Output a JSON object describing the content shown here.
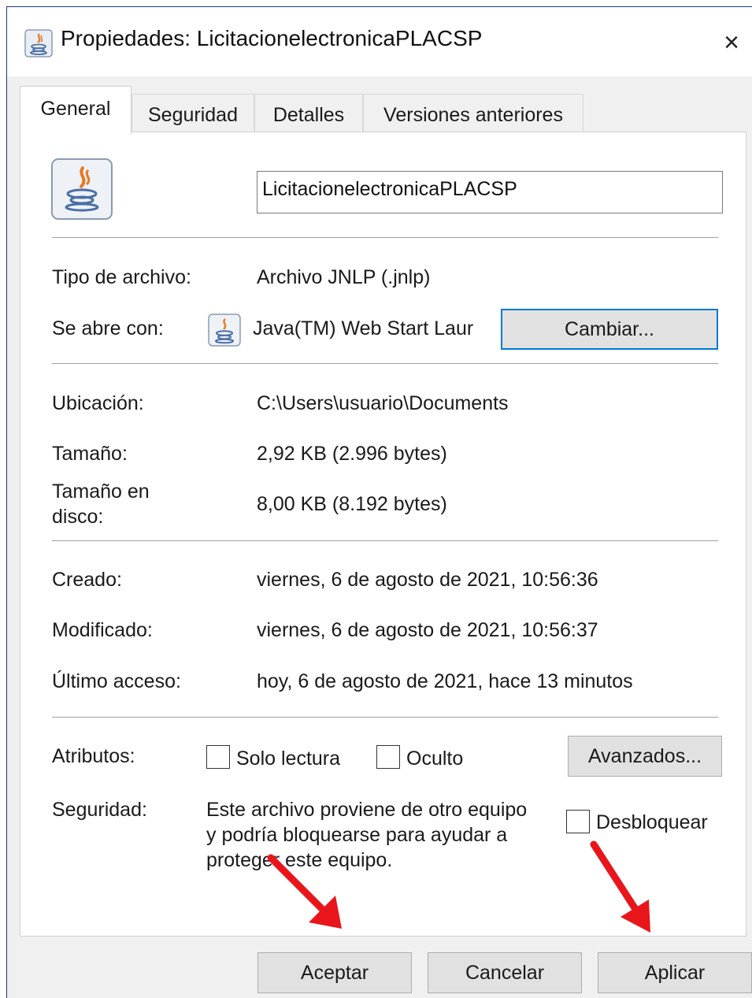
{
  "window": {
    "title": "Propiedades: LicitacionelectronicaPLACSP",
    "close_glyph": "×"
  },
  "tabs": [
    {
      "label": "General",
      "active": true
    },
    {
      "label": "Seguridad",
      "active": false
    },
    {
      "label": "Detalles",
      "active": false
    },
    {
      "label": "Versiones anteriores",
      "active": false
    }
  ],
  "file": {
    "name": "LicitacionelectronicaPLACSP",
    "icon": "java-cup-icon"
  },
  "rows": {
    "type_label": "Tipo de archivo:",
    "type_value": "Archivo JNLP (.jnlp)",
    "opens_label": "Se abre con:",
    "opens_value": "Java(TM) Web Start Laur",
    "change_button": "Cambiar...",
    "location_label": "Ubicación:",
    "location_value": "C:\\Users\\usuario\\Documents",
    "size_label": "Tamaño:",
    "size_value": "2,92 KB (2.996 bytes)",
    "disk_label_line1": "Tamaño en",
    "disk_label_line2": "disco:",
    "disk_value": "8,00 KB (8.192 bytes)",
    "created_label": "Creado:",
    "created_value": "viernes, 6 de agosto de 2021, 10:56:36",
    "modified_label": "Modificado:",
    "modified_value": "viernes, 6 de agosto de 2021, 10:56:37",
    "accessed_label": "Último acceso:",
    "accessed_value": "hoy, 6 de agosto de 2021, hace 13 minutos"
  },
  "attributes": {
    "label": "Atributos:",
    "readonly_label": "Solo lectura",
    "readonly_checked": false,
    "hidden_label": "Oculto",
    "hidden_checked": false,
    "advanced_button": "Avanzados..."
  },
  "security": {
    "label": "Seguridad:",
    "text_line1": "Este archivo proviene de otro equipo",
    "text_line2": "y podría bloquearse para ayudar a",
    "text_line3": "proteger este equipo.",
    "unblock_label": "Desbloquear",
    "unblock_checked": false
  },
  "footer": {
    "ok": "Aceptar",
    "cancel": "Cancelar",
    "apply": "Aplicar"
  },
  "colors": {
    "annotation_arrow": "#e8161b",
    "focus_border": "#0078d7"
  }
}
